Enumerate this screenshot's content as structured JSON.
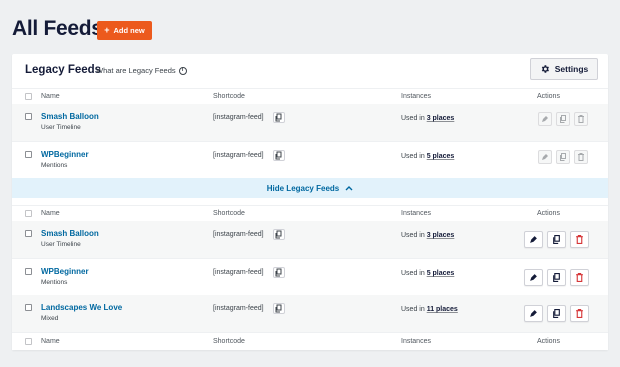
{
  "page": {
    "title": "All Feeds"
  },
  "add_new": {
    "label": "Add new",
    "plus": "+"
  },
  "legacy": {
    "title": "Legacy Feeds",
    "help": "What are Legacy Feeds",
    "settings_label": "Settings",
    "toggle_label": "Hide Legacy Feeds"
  },
  "columns": {
    "name": "Name",
    "shortcode": "Shortcode",
    "instances": "Instances",
    "actions": "Actions"
  },
  "legacy_rows": [
    {
      "name": "Smash Balloon",
      "type": "User Timeline",
      "shortcode": "[instagram-feed]",
      "used_prefix": "Used in",
      "used_link": "3 places"
    },
    {
      "name": "WPBeginner",
      "type": "Mentions",
      "shortcode": "[instagram-feed]",
      "used_prefix": "Used in",
      "used_link": "5 places"
    }
  ],
  "feed_rows": [
    {
      "name": "Smash Balloon",
      "type": "User Timeline",
      "shortcode": "[instagram-feed]",
      "used_prefix": "Used in",
      "used_link": "3 places"
    },
    {
      "name": "WPBeginner",
      "type": "Mentions",
      "shortcode": "[instagram-feed]",
      "used_prefix": "Used in",
      "used_link": "5 places"
    },
    {
      "name": "Landscapes We Love",
      "type": "Mixed",
      "shortcode": "[instagram-feed]",
      "used_prefix": "Used in",
      "used_link": "11 places"
    }
  ],
  "colors": {
    "accent": "#ec5a1d",
    "link": "#0068a0",
    "delete": "#d63638",
    "title": "#141b38"
  },
  "icons": {
    "settings": "gear-icon",
    "info": "info-icon",
    "copy": "copy-icon",
    "edit": "pencil-icon",
    "duplicate": "duplicate-icon",
    "delete": "trash-icon",
    "toggle": "chevron-up-icon"
  }
}
